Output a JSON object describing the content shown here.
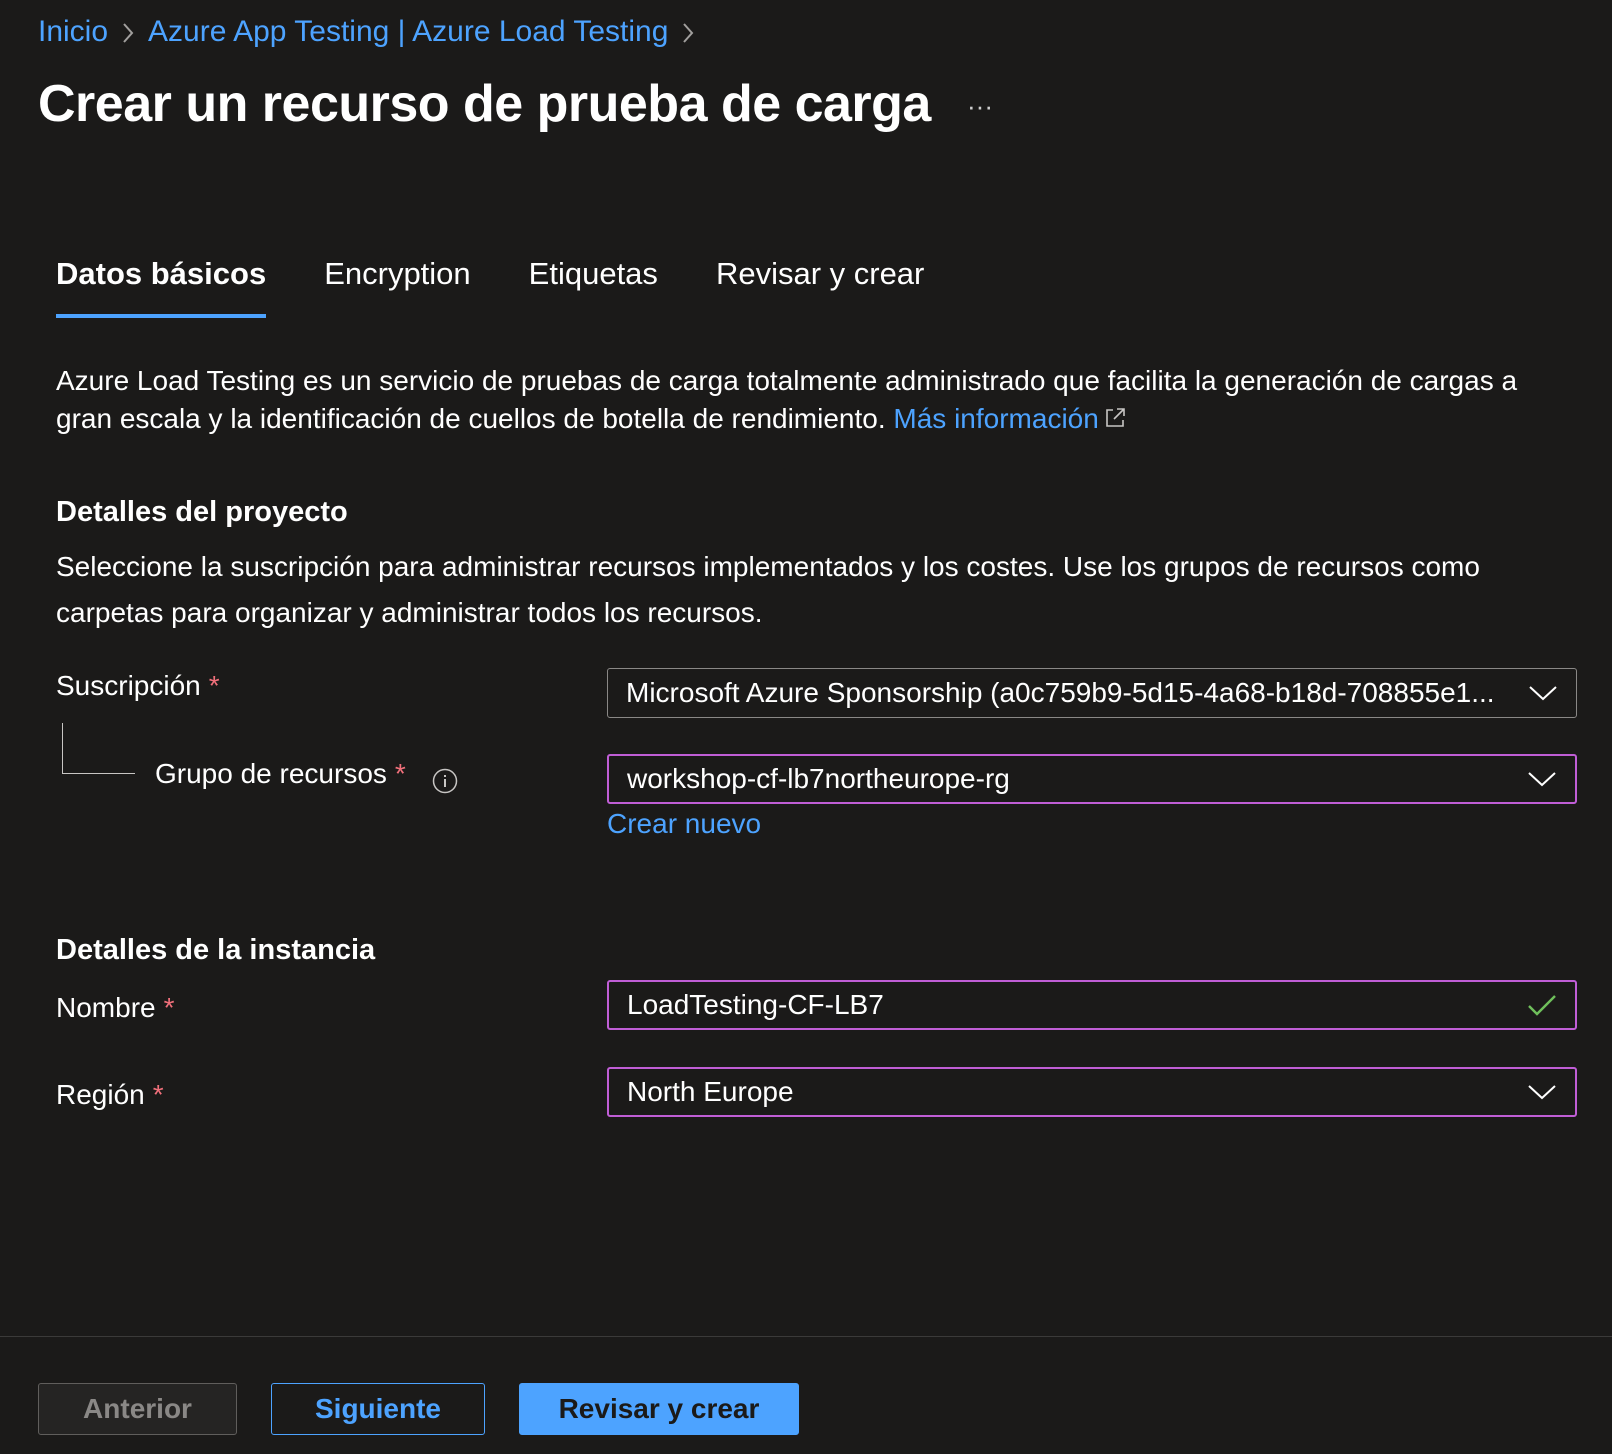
{
  "breadcrumb": {
    "items": [
      "Inicio",
      "Azure App Testing | Azure Load Testing"
    ]
  },
  "page": {
    "title": "Crear un recurso de prueba de carga",
    "more_label": "···"
  },
  "tabs": [
    {
      "label": "Datos básicos",
      "active": true
    },
    {
      "label": "Encryption",
      "active": false
    },
    {
      "label": "Etiquetas",
      "active": false
    },
    {
      "label": "Revisar y crear",
      "active": false
    }
  ],
  "intro": {
    "text": "Azure Load Testing es un servicio de pruebas de carga totalmente administrado que facilita la generación de cargas a gran escala y la identificación de cuellos de botella de rendimiento.",
    "link_label": "Más información"
  },
  "project": {
    "title": "Detalles del proyecto",
    "description": "Seleccione la suscripción para administrar recursos implementados y los costes. Use los grupos de recursos como carpetas para organizar y administrar todos los recursos.",
    "subscription_label": "Suscripción",
    "subscription_value": "Microsoft Azure Sponsorship (a0c759b9-5d15-4a68-b18d-708855e1...",
    "resource_group_label": "Grupo de recursos",
    "resource_group_value": "workshop-cf-lb7northeurope-rg",
    "create_new_label": "Crear nuevo"
  },
  "instance": {
    "title": "Detalles de la instancia",
    "name_label": "Nombre",
    "name_value": "LoadTesting-CF-LB7",
    "region_label": "Región",
    "region_value": "North Europe"
  },
  "required_mark": "*",
  "footer": {
    "prev_label": "Anterior",
    "next_label": "Siguiente",
    "review_label": "Revisar y crear"
  },
  "colors": {
    "background": "#1b1a19",
    "link": "#4da3ff",
    "focus_border": "#c05ed6",
    "required": "#f1707b",
    "valid_check": "#6fbf5b"
  }
}
